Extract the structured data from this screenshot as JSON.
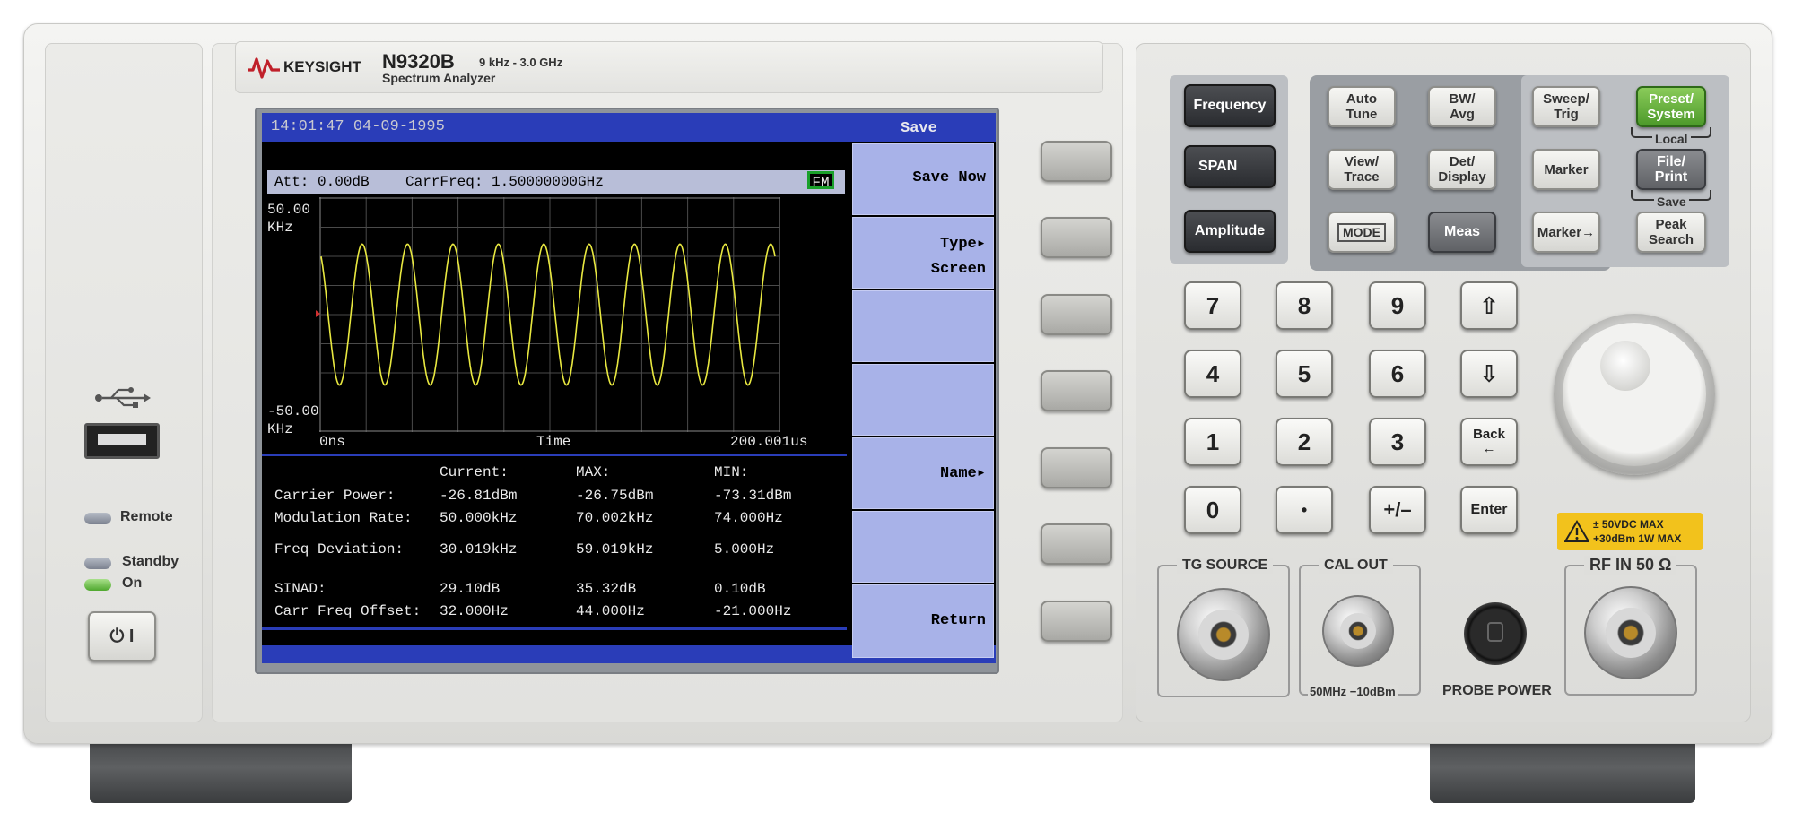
{
  "device": {
    "brand": "KEYSIGHT",
    "model": "N9320B",
    "range": "9 kHz - 3.0 GHz",
    "subtitle": "Spectrum Analyzer"
  },
  "left_panel": {
    "usb_icon": "usb-icon",
    "led_remote": "Remote",
    "led_standby": "Standby",
    "led_on": "On",
    "power_label": "⏻ I"
  },
  "screen": {
    "datetime": "14:01:47 04-09-1995",
    "menu_title": "Save",
    "att": "Att: 0.00dB",
    "carrfreq": "CarrFreq: 1.50000000GHz",
    "mode_badge": "FM",
    "y_top": "50.00",
    "y_top_unit": "KHz",
    "y_bottom": "-50.00",
    "y_bottom_unit": "KHz",
    "x_left": "0ns",
    "x_label": "Time",
    "x_right": "200.001us",
    "meas_headers": [
      "Current:",
      "MAX:",
      "MIN:"
    ],
    "meas_rows": [
      {
        "name": "Carrier Power:",
        "current": "-26.81dBm",
        "max": "-26.75dBm",
        "min": "-73.31dBm"
      },
      {
        "name": "Modulation Rate:",
        "current": "50.000kHz",
        "max": "70.002kHz",
        "min": "74.000Hz"
      },
      {
        "name": "Freq Deviation:",
        "current": "30.019kHz",
        "max": "59.019kHz",
        "min": "5.000Hz"
      },
      {
        "name": "SINAD:",
        "current": "29.10dB",
        "max": "35.32dB",
        "min": "0.10dB"
      },
      {
        "name": "Carr Freq Offset:",
        "current": "32.000Hz",
        "max": "44.000Hz",
        "min": "-21.000Hz"
      }
    ],
    "softkeys": [
      {
        "line1": "Save Now",
        "line2": ""
      },
      {
        "line1": "Type▸",
        "line2": "Screen"
      },
      {
        "line1": "",
        "line2": ""
      },
      {
        "line1": "",
        "line2": ""
      },
      {
        "line1": "Name▸",
        "line2": ""
      },
      {
        "line1": "",
        "line2": ""
      },
      {
        "line1": "Return",
        "line2": ""
      }
    ],
    "trace": {
      "cycles": 10,
      "amplitude_fraction": 0.6,
      "color": "#e8e840"
    }
  },
  "keys": {
    "frequency": "Frequency",
    "span": "SPAN",
    "amplitude": "Amplitude",
    "auto_tune": [
      "Auto",
      "Tune"
    ],
    "bw_avg": [
      "BW/",
      "Avg"
    ],
    "sweep_trig": [
      "Sweep/",
      "Trig"
    ],
    "preset_system": [
      "Preset/",
      "System"
    ],
    "local": "Local",
    "view_trace": [
      "View/",
      "Trace"
    ],
    "det_display": [
      "Det/",
      "Display"
    ],
    "marker": "Marker",
    "file_print": [
      "File/",
      "Print"
    ],
    "save": "Save",
    "mode": "MODE",
    "meas": "Meas",
    "marker_arrow": "Marker→",
    "peak_search": [
      "Peak",
      "Search"
    ],
    "numpad": [
      "7",
      "8",
      "9",
      "4",
      "5",
      "6",
      "1",
      "2",
      "3",
      "0",
      "•",
      "+/–"
    ],
    "up": "⇧",
    "down": "⇩",
    "back": [
      "Back",
      "←"
    ],
    "enter": "Enter"
  },
  "ports": {
    "tg_source": "TG SOURCE",
    "cal_out": "CAL OUT",
    "cal_out_spec": "50MHz −10dBm",
    "probe_power": "PROBE POWER",
    "rf_in": "RF IN 50 Ω",
    "warning_line1": "± 50VDC MAX",
    "warning_line2": "+30dBm 1W MAX"
  },
  "colors": {
    "softkey": "#a8b2e8",
    "title_bar": "#2a3db8",
    "trace": "#e8e840",
    "preset": "#5aa830",
    "warning": "#f2c21c"
  }
}
